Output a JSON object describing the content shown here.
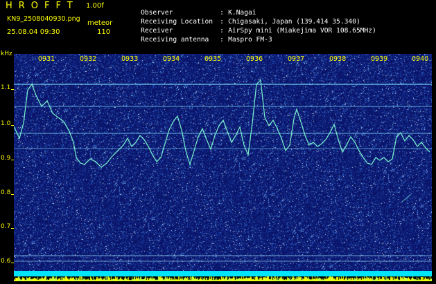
{
  "header": {
    "app_title": "HROFFT",
    "version": "1.00f",
    "filename": "KN9_2508040930.png",
    "meteor_label": "meteor",
    "datetime": "25.08.04 09:30",
    "meteor_count": "110"
  },
  "info": [
    {
      "key": "Observer",
      "value": "K.Nagai"
    },
    {
      "key": "Receiving Location",
      "value": "Chigasaki, Japan (139.414 35.340)"
    },
    {
      "key": "Receiver",
      "value": "AirSpy mini (Miakejima VOR 108.65MHz)"
    },
    {
      "key": "Receiving antenna",
      "value": "Maspro FM-3"
    }
  ],
  "axis": {
    "unit": "kHz",
    "y_labels": [
      "1.1",
      "1.0",
      "0.9",
      "0.8",
      "0.7",
      "0.6"
    ],
    "x_labels": [
      "0931",
      "0932",
      "0933",
      "0934",
      "0935",
      "0936",
      "0937",
      "0938",
      "0939",
      "0940"
    ]
  },
  "colors": {
    "background": "#0a1468",
    "text_primary": "#ffff00",
    "text_info": "#ffffff",
    "trace": "#7fffd4",
    "bottom_bar": "#00e5ff"
  }
}
